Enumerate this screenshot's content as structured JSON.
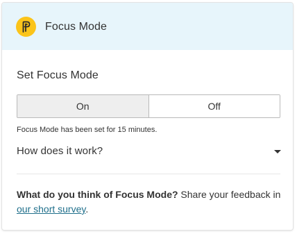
{
  "header": {
    "logo_icon": "focus-mode-logo-icon",
    "title": "Focus Mode"
  },
  "section": {
    "title": "Set Focus Mode"
  },
  "toggle": {
    "on_label": "On",
    "off_label": "Off",
    "selected": "On"
  },
  "status": {
    "text": "Focus Mode has been set for 15 minutes."
  },
  "how_it_works": {
    "label": "How does it work?",
    "icon": "caret-down-icon"
  },
  "feedback": {
    "question": "What do you think of Focus Mode?",
    "prompt": " Share your feedback in ",
    "link_text": "our short survey",
    "end": "."
  },
  "colors": {
    "header_bg": "#e7f5fb",
    "logo_bg": "#fbc41a",
    "link": "#1f6f8b",
    "active_toggle_bg": "#eeeeee"
  }
}
